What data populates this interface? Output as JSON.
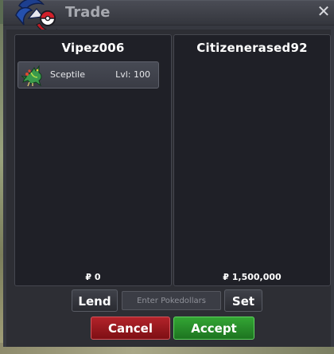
{
  "window": {
    "title": "Trade",
    "close_symbol": "✕"
  },
  "left_panel": {
    "player_name": "Vipez006",
    "items": [
      {
        "icon": "sceptile-sprite",
        "name": "Sceptile",
        "level": "Lvl: 100"
      }
    ],
    "money": "₽ 0"
  },
  "right_panel": {
    "player_name": "Citizenerased92",
    "items": [],
    "money": "₽ 1,500,000"
  },
  "controls": {
    "lend_label": "Lend",
    "amount_placeholder": "Enter Pokedollars",
    "set_label": "Set",
    "cancel_label": "Cancel",
    "accept_label": "Accept"
  },
  "colors": {
    "cancel": "#9a1a20",
    "accept": "#2a8c2c",
    "panel": "#1f2027"
  }
}
